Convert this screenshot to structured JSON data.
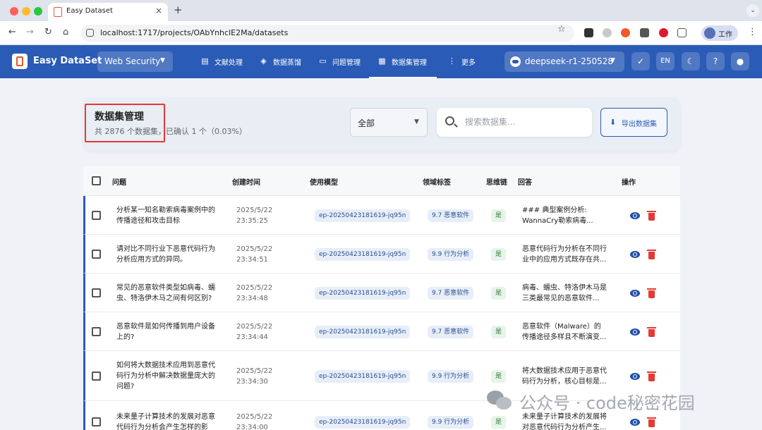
{
  "browser": {
    "tab_title": "Easy Dataset",
    "url": "localhost:1717/projects/OAbYnhclE2Ma/datasets",
    "profile_label": "工作"
  },
  "header": {
    "brand": "Easy DataSet",
    "project": "Web Security",
    "nav": [
      {
        "label": "文献处理",
        "icon": "document-icon"
      },
      {
        "label": "数据蒸馏",
        "icon": "cube-icon"
      },
      {
        "label": "问题管理",
        "icon": "chat-icon"
      },
      {
        "label": "数据集管理",
        "icon": "grid-icon",
        "active": true
      },
      {
        "label": "更多",
        "icon": "more-vertical-icon"
      }
    ],
    "model": "deepseek-r1-250528",
    "lang": "EN"
  },
  "toolbar": {
    "title": "数据集管理",
    "subtitle": "共 2876 个数据集，已确认 1 个（0.03%）",
    "filter_value": "全部",
    "search_placeholder": "搜索数据集...",
    "export_label": "导出数据集"
  },
  "table": {
    "headers": {
      "question": "问题",
      "created": "创建时间",
      "model": "使用模型",
      "domain": "领域标签",
      "cot": "思维链",
      "answer": "回答",
      "actions": "操作"
    },
    "rows": [
      {
        "q1": "分析某一知名勒索病毒案例中的",
        "q2": "传播途径和攻击目标",
        "q3": "",
        "date": "2025/5/22",
        "time": "23:35:25",
        "model": "ep-20250423181619-jq95n",
        "domain": "9.7 恶意软件",
        "cot": "是",
        "a1": "### 典型案例分析:",
        "a2": "WannaCry勒索病毒..."
      },
      {
        "q1": "请对比不同行业下恶意代码行为",
        "q2": "分析应用方式的异同。",
        "q3": "",
        "date": "2025/5/22",
        "time": "23:34:51",
        "model": "ep-20250423181619-jq95n",
        "domain": "9.9 行为分析",
        "cot": "是",
        "a1": "恶意代码行为分析在不同行",
        "a2": "业中的应用方式既存在共..."
      },
      {
        "q1": "常见的恶意软件类型如病毒、蠕",
        "q2": "虫、特洛伊木马之间有何区别?",
        "q3": "",
        "date": "2025/5/22",
        "time": "23:34:48",
        "model": "ep-20250423181619-jq95n",
        "domain": "9.7 恶意软件",
        "cot": "是",
        "a1": "病毒、蠕虫、特洛伊木马是",
        "a2": "三类最常见的恶意软件..."
      },
      {
        "q1": "恶意软件是如何传播到用户设备",
        "q2": "上的?",
        "q3": "",
        "date": "2025/5/22",
        "time": "23:34:44",
        "model": "ep-20250423181619-jq95n",
        "domain": "9.7 恶意软件",
        "cot": "是",
        "a1": "恶意软件（Malware）的",
        "a2": "传播途径多样且不断演变..."
      },
      {
        "q1": "如何将大数据技术应用到恶意代",
        "q2": "码行为分析中解决数据量庞大的",
        "q3": "问题?",
        "date": "2025/5/22",
        "time": "23:34:30",
        "model": "ep-20250423181619-jq95n",
        "domain": "9.9 行为分析",
        "cot": "是",
        "a1": "将大数据技术应用于恶意代",
        "a2": "码行为分析，核心目标是..."
      },
      {
        "q1": "未来量子计算技术的发展对恶意",
        "q2": "代码行为分析会产生怎样的影",
        "q3": "",
        "date": "2025/5/22",
        "time": "23:34:00",
        "model": "ep-20250423181619-jq95n",
        "domain": "9.9 行为分析",
        "cot": "是",
        "a1": "未来量子计算技术的发展将",
        "a2": "对恶意代码行为分析产生..."
      }
    ]
  },
  "watermark": "公众号 · code秘密花园"
}
